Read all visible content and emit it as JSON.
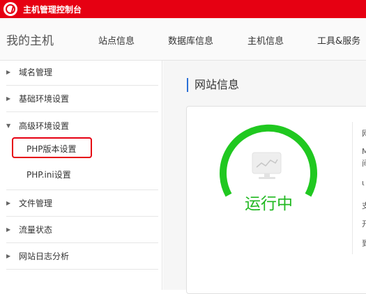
{
  "header": {
    "title": "主机管理控制台",
    "logo_icon": "pinwheel-logo-icon",
    "bg_color": "#e60012"
  },
  "nav": {
    "brand": "我的主机",
    "items": [
      "站点信息",
      "数据库信息",
      "主机信息",
      "工具&服务"
    ]
  },
  "sidebar": {
    "items": [
      {
        "label": "域名管理",
        "expanded": false
      },
      {
        "label": "基础环境设置",
        "expanded": false
      },
      {
        "label": "高级环境设置",
        "expanded": true
      },
      {
        "label": "文件管理",
        "expanded": false
      },
      {
        "label": "流量状态",
        "expanded": false
      },
      {
        "label": "网站日志分析",
        "expanded": false
      }
    ],
    "sub_items": [
      "PHP版本设置",
      "PHP.ini设置"
    ]
  },
  "main": {
    "section_title": "网站信息",
    "status": "运行中",
    "status_color": "#20b820",
    "gauge_icon": "monitor-chart-icon",
    "info_chars": [
      "网",
      "M",
      "间",
      "ι",
      "支",
      "开",
      "到"
    ]
  }
}
